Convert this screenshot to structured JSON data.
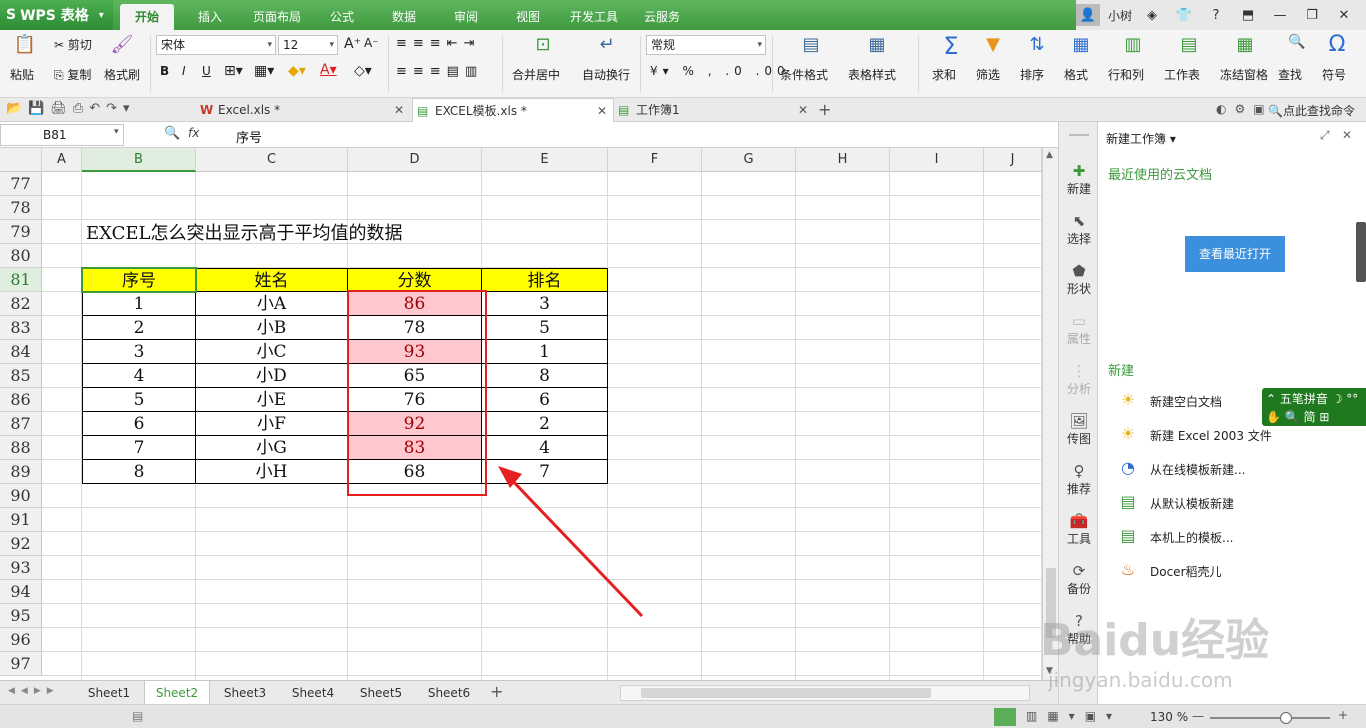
{
  "app": {
    "name": "WPS 表格"
  },
  "menu": [
    "开始",
    "插入",
    "页面布局",
    "公式",
    "数据",
    "审阅",
    "视图",
    "开发工具",
    "云服务"
  ],
  "user": {
    "name": "小树"
  },
  "ribbon": {
    "paste": "粘贴",
    "cut": "剪切",
    "copy": "复制",
    "format_painter": "格式刷",
    "font_name": "宋体",
    "font_size": "12",
    "merge_center": "合并居中",
    "wrap_text": "自动换行",
    "number_format": "常规",
    "cond_format": "条件格式",
    "table_style": "表格样式",
    "sum": "求和",
    "filter": "筛选",
    "sort": "排序",
    "format": "格式",
    "rows_cols": "行和列",
    "worksheet": "工作表",
    "freeze": "冻结窗格",
    "find": "查找",
    "symbol": "符号"
  },
  "doc_tabs": [
    {
      "label": "Excel.xls *"
    },
    {
      "label": "EXCEL模板.xls *"
    },
    {
      "label": "工作簿1"
    }
  ],
  "search": {
    "label": "点此查找命令"
  },
  "formula_bar": {
    "cell_ref": "B81",
    "fx": "fx",
    "content": "序号"
  },
  "columns": [
    "A",
    "B",
    "C",
    "D",
    "E",
    "F",
    "G",
    "H",
    "I",
    "J"
  ],
  "rows": [
    "77",
    "78",
    "79",
    "80",
    "81",
    "82",
    "83",
    "84",
    "85",
    "86",
    "87",
    "88",
    "89",
    "90",
    "91",
    "92",
    "93",
    "94",
    "95",
    "96",
    "97"
  ],
  "sheet_title": "EXCEL怎么突出显示高于平均值的数据",
  "table": {
    "headers": [
      "序号",
      "姓名",
      "分数",
      "排名"
    ],
    "rows": [
      [
        "1",
        "小A",
        "86",
        "3"
      ],
      [
        "2",
        "小B",
        "78",
        "5"
      ],
      [
        "3",
        "小C",
        "93",
        "1"
      ],
      [
        "4",
        "小D",
        "65",
        "8"
      ],
      [
        "5",
        "小E",
        "76",
        "6"
      ],
      [
        "6",
        "小F",
        "92",
        "2"
      ],
      [
        "7",
        "小G",
        "83",
        "4"
      ],
      [
        "8",
        "小H",
        "68",
        "7"
      ]
    ],
    "highlight_color": "#ffc7ce",
    "highlight_text_color": "#9c0006",
    "header_fill": "#ffff00"
  },
  "sheets": [
    "Sheet1",
    "Sheet2",
    "Sheet3",
    "Sheet4",
    "Sheet5",
    "Sheet6"
  ],
  "active_sheet": "Sheet2",
  "status": {
    "zoom": "130 %"
  },
  "sidebar": [
    "新建",
    "选择",
    "形状",
    "属性",
    "分析",
    "传图",
    "推荐",
    "工具",
    "备份",
    "帮助"
  ],
  "panel": {
    "title": "新建工作簿",
    "cloud_header": "最近使用的云文档",
    "view_recent": "查看最近打开",
    "new_header": "新建",
    "links": [
      "新建空白文档",
      "新建 Excel 2003 文件",
      "从在线模板新建...",
      "从默认模板新建",
      "本机上的模板...",
      "Docer稻壳儿"
    ]
  },
  "ime": {
    "line1": "五笔拼音",
    "line2": "简"
  },
  "watermark": {
    "text": "Baidu经验",
    "sub": "jingyan.baidu.com"
  },
  "accent": "#3c9a3c"
}
